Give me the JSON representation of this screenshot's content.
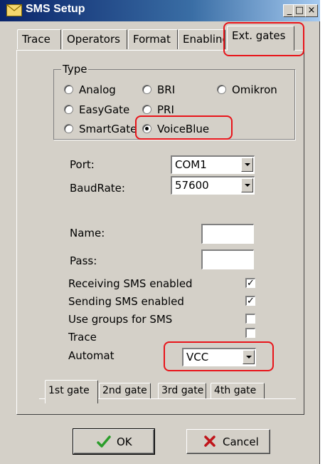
{
  "window": {
    "title": "SMS Setup",
    "controls": [
      "_",
      "□",
      "×"
    ]
  },
  "tabs": [
    {
      "label": "Trace",
      "active": false
    },
    {
      "label": "Operators",
      "active": false
    },
    {
      "label": "Format",
      "active": false
    },
    {
      "label": "Enabling",
      "active": false
    },
    {
      "label": "Ext. gates",
      "active": true
    }
  ],
  "type_group": {
    "legend": "Type",
    "options": [
      {
        "label": "Analog",
        "selected": false
      },
      {
        "label": "BRI",
        "selected": false
      },
      {
        "label": "Omikron",
        "selected": false
      },
      {
        "label": "EasyGate",
        "selected": false
      },
      {
        "label": "PRI",
        "selected": false
      },
      {
        "label": "SmartGate",
        "selected": false
      },
      {
        "label": "VoiceBlue",
        "selected": true
      }
    ]
  },
  "port": {
    "label": "Port:",
    "value": "COM1"
  },
  "baudrate": {
    "label": "BaudRate:",
    "value": "57600"
  },
  "name": {
    "label": "Name:",
    "value": ""
  },
  "pass": {
    "label": "Pass:",
    "value": ""
  },
  "checks": [
    {
      "label": "Receiving SMS enabled",
      "checked": true
    },
    {
      "label": "Sending SMS enabled",
      "checked": true
    },
    {
      "label": "Use groups for SMS",
      "checked": false
    },
    {
      "label": "Trace",
      "checked": false
    }
  ],
  "automat": {
    "label": "Automat",
    "value": "VCC"
  },
  "gate_tabs": [
    {
      "label": "1st gate",
      "active": true
    },
    {
      "label": "2nd gate",
      "active": false
    },
    {
      "label": "3rd gate",
      "active": false
    },
    {
      "label": "4th gate",
      "active": false
    }
  ],
  "buttons": {
    "ok": "OK",
    "cancel": "Cancel"
  },
  "colors": {
    "title_bar": "#0a246a",
    "face": "#d4d0c8",
    "highlight": "#e8141a",
    "ok_check": "#2a9d2a",
    "cancel_x": "#c0141a"
  },
  "icons": {
    "title": "envelope-icon",
    "ok": "checkmark-icon",
    "cancel": "x-icon"
  }
}
